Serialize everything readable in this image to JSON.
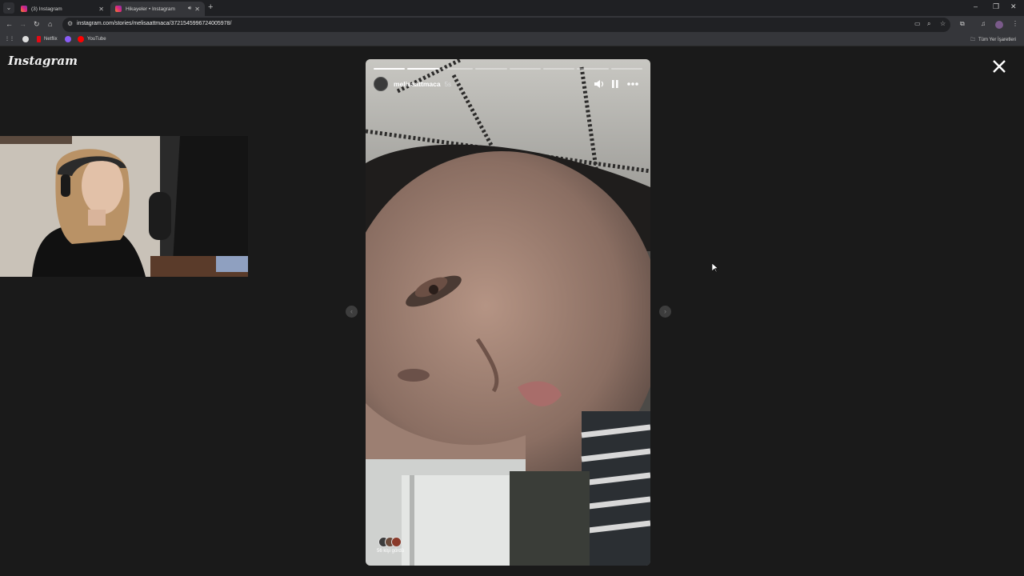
{
  "browser": {
    "tabs": [
      {
        "title": "(3) Instagram",
        "active": false
      },
      {
        "title": "Hikayeler • Instagram",
        "active": true
      }
    ],
    "url": "instagram.com/stories/melisaattmaca/3721545996724005978/",
    "bookmarks": [
      {
        "label": "Netflix",
        "color": "#e50914"
      },
      {
        "label": "YouTube",
        "color": "#ff0000"
      }
    ],
    "all_bookmarks_label": "Tüm Yer İşaretleri"
  },
  "page": {
    "logo": "Instagram",
    "story": {
      "username": "melisaattmaca",
      "time_ago": "5s",
      "viewers_label": "56 kişi gördü",
      "progress_segments": 8,
      "progress_complete": 1,
      "progress_current_fraction": 1.0
    }
  },
  "colors": {
    "background": "#1a1a1a",
    "accent_instagram": "#dd2a7b"
  },
  "icons": [
    "close-icon",
    "mute-icon",
    "pause-icon",
    "more-icon",
    "prev-arrow-icon",
    "next-arrow-icon",
    "reload-icon",
    "back-icon",
    "forward-icon",
    "home-icon"
  ]
}
